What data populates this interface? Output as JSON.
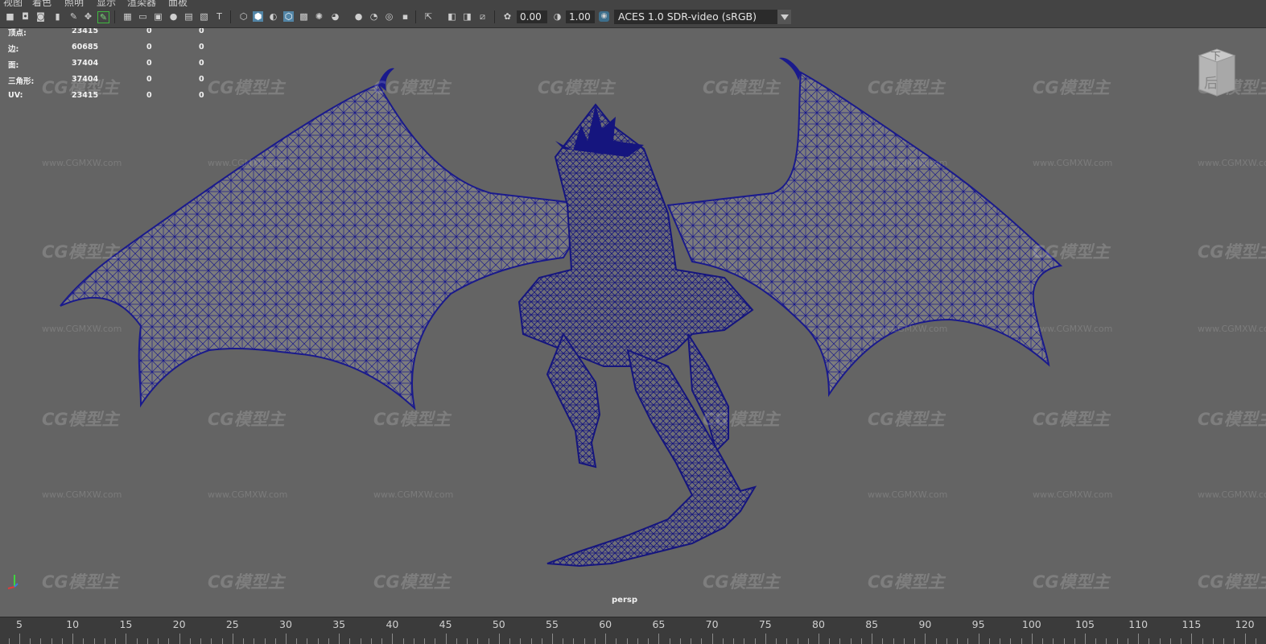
{
  "menubar": {
    "items": [
      "视图",
      "着色",
      "照明",
      "显示",
      "渲染器",
      "面板"
    ]
  },
  "toolbar": {
    "exposure": "0.00",
    "gamma": "1.00",
    "color_space": "ACES 1.0 SDR-video (sRGB)"
  },
  "hud": {
    "rows": [
      {
        "label": "顶点:",
        "v1": "23415",
        "v2": "0",
        "v3": "0"
      },
      {
        "label": "边:",
        "v1": "60685",
        "v2": "0",
        "v3": "0"
      },
      {
        "label": "面:",
        "v1": "37404",
        "v2": "0",
        "v3": "0"
      },
      {
        "label": "三角形:",
        "v1": "37404",
        "v2": "0",
        "v3": "0"
      },
      {
        "label": "UV:",
        "v1": "23415",
        "v2": "0",
        "v3": "0"
      }
    ]
  },
  "viewport": {
    "camera_label": "persp",
    "viewcube_top": "下",
    "viewcube_face": "后",
    "wireframe_color": "#1a1a8c",
    "mesh_shading": "#7c7c7c"
  },
  "watermark": {
    "logo": "CG模型主",
    "url": "www.CGMXW.com"
  },
  "timeline": {
    "ticks": [
      "5",
      "10",
      "15",
      "20",
      "25",
      "30",
      "35",
      "40",
      "45",
      "50",
      "55",
      "60",
      "65",
      "70",
      "75",
      "80",
      "85",
      "90",
      "95",
      "100",
      "105",
      "110",
      "115",
      "120"
    ]
  }
}
